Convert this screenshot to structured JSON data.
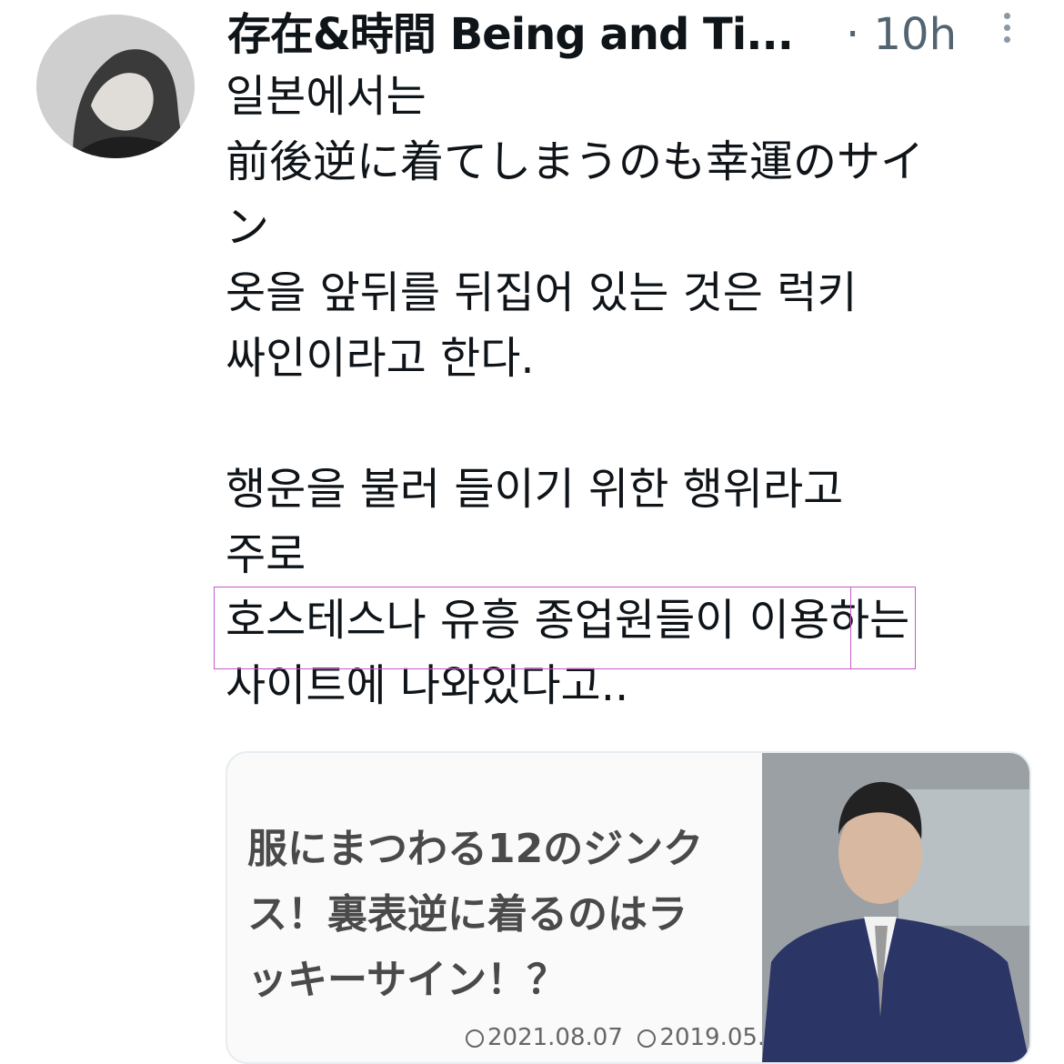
{
  "tweet": {
    "author": "存在&時間 Being and Ti...",
    "time": "· 10h",
    "more_icon": "more-vertical-icon",
    "lines": [
      "일본에서는",
      "前後逆に着てしまうのも幸運のサイ",
      "ン",
      "옷을 앞뒤를 뒤집어 있는 것은 럭키",
      "싸인이라고 한다.",
      "",
      "행운을 불러 들이기 위한 행위라고",
      "주로",
      "호스테스나 유흥 종업원들이 이용하는",
      "사이트에 나와있다고.."
    ]
  },
  "card": {
    "title_lines": [
      "服にまつわる12のジンク",
      "ス！裏表逆に着るのはラ",
      "ッキーサイン！？"
    ],
    "updated_date": "2021.08.07",
    "published_date": "2019.05."
  },
  "colors": {
    "highlight_border": "#c65bc6",
    "secondary_text": "#536471"
  }
}
